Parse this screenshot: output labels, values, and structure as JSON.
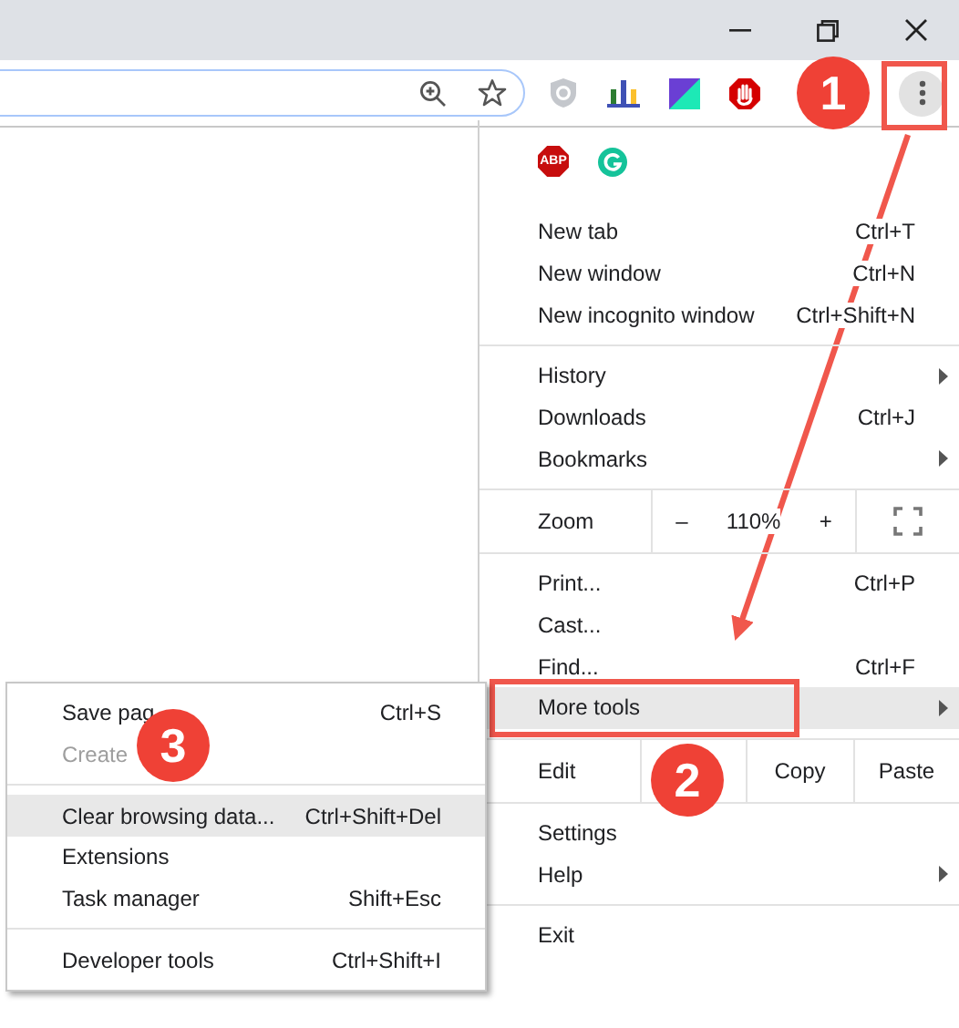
{
  "menu": {
    "abp_label": "ABP",
    "sections": [
      {
        "kind": "list",
        "items": [
          {
            "label": "New tab",
            "shortcut": "Ctrl+T",
            "submenu": false,
            "selected": false
          },
          {
            "label": "New window",
            "shortcut": "Ctrl+N",
            "submenu": false,
            "selected": false
          },
          {
            "label": "New incognito window",
            "shortcut": "Ctrl+Shift+N",
            "submenu": false,
            "selected": false
          }
        ]
      },
      {
        "kind": "list",
        "items": [
          {
            "label": "History",
            "submenu": true,
            "selected": false
          },
          {
            "label": "Downloads",
            "shortcut": "Ctrl+J",
            "submenu": false,
            "selected": false
          },
          {
            "label": "Bookmarks",
            "submenu": true,
            "selected": false
          }
        ]
      },
      {
        "kind": "zoom",
        "label": "Zoom",
        "minus": "–",
        "value": "110%",
        "plus": "+"
      },
      {
        "kind": "list",
        "items": [
          {
            "label": "Print...",
            "shortcut": "Ctrl+P",
            "submenu": false,
            "selected": false
          },
          {
            "label": "Cast...",
            "submenu": false,
            "selected": false
          },
          {
            "label": "Find...",
            "shortcut": "Ctrl+F",
            "submenu": false,
            "selected": false
          },
          {
            "label": "More tools",
            "submenu": true,
            "selected": true
          }
        ]
      },
      {
        "kind": "edit",
        "label": "Edit",
        "actions": [
          "Copy",
          "Paste"
        ]
      },
      {
        "kind": "list",
        "items": [
          {
            "label": "Settings",
            "submenu": false,
            "selected": false
          },
          {
            "label": "Help",
            "submenu": true,
            "selected": false
          }
        ]
      },
      {
        "kind": "list",
        "items": [
          {
            "label": "Exit",
            "submenu": false,
            "selected": false
          }
        ]
      }
    ]
  },
  "submenu": {
    "sections": [
      [
        {
          "label": "Save pag",
          "shortcut": "Ctrl+S",
          "disabled": false,
          "selected": false
        },
        {
          "label": "Create",
          "disabled": true,
          "selected": false
        }
      ],
      [
        {
          "label": "Clear browsing data...",
          "shortcut": "Ctrl+Shift+Del",
          "disabled": false,
          "selected": true
        },
        {
          "label": "Extensions",
          "disabled": false,
          "selected": false
        },
        {
          "label": "Task manager",
          "shortcut": "Shift+Esc",
          "disabled": false,
          "selected": false
        }
      ],
      [
        {
          "label": "Developer tools",
          "shortcut": "Ctrl+Shift+I",
          "disabled": false,
          "selected": false
        }
      ]
    ]
  },
  "annotations": [
    {
      "number": "1"
    },
    {
      "number": "2"
    },
    {
      "number": "3"
    }
  ]
}
